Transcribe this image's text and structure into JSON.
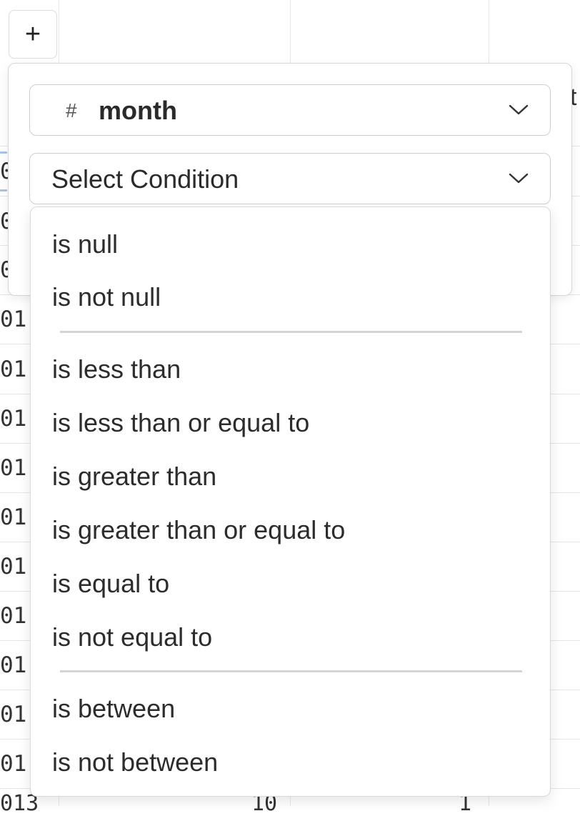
{
  "toolbar": {
    "add_label": "+"
  },
  "background_table": {
    "row_fragments": [
      "0",
      "0",
      "0",
      "01",
      "01",
      "01",
      "01",
      "01",
      "01",
      "01",
      "01",
      "01",
      "01"
    ],
    "header_fragment": "t",
    "bottom_fragments": [
      "013",
      "10",
      "1"
    ]
  },
  "filter": {
    "field": {
      "type_icon": "#",
      "name": "month",
      "chevron": "chevron-down-icon"
    },
    "condition": {
      "placeholder": "Select Condition",
      "chevron": "chevron-down-icon"
    }
  },
  "condition_menu": {
    "groups": [
      [
        "is null",
        "is not null"
      ],
      [
        "is less than",
        "is less than or equal to",
        "is greater than",
        "is greater than or equal to",
        "is equal to",
        "is not equal to"
      ],
      [
        "is between",
        "is not between"
      ]
    ]
  }
}
